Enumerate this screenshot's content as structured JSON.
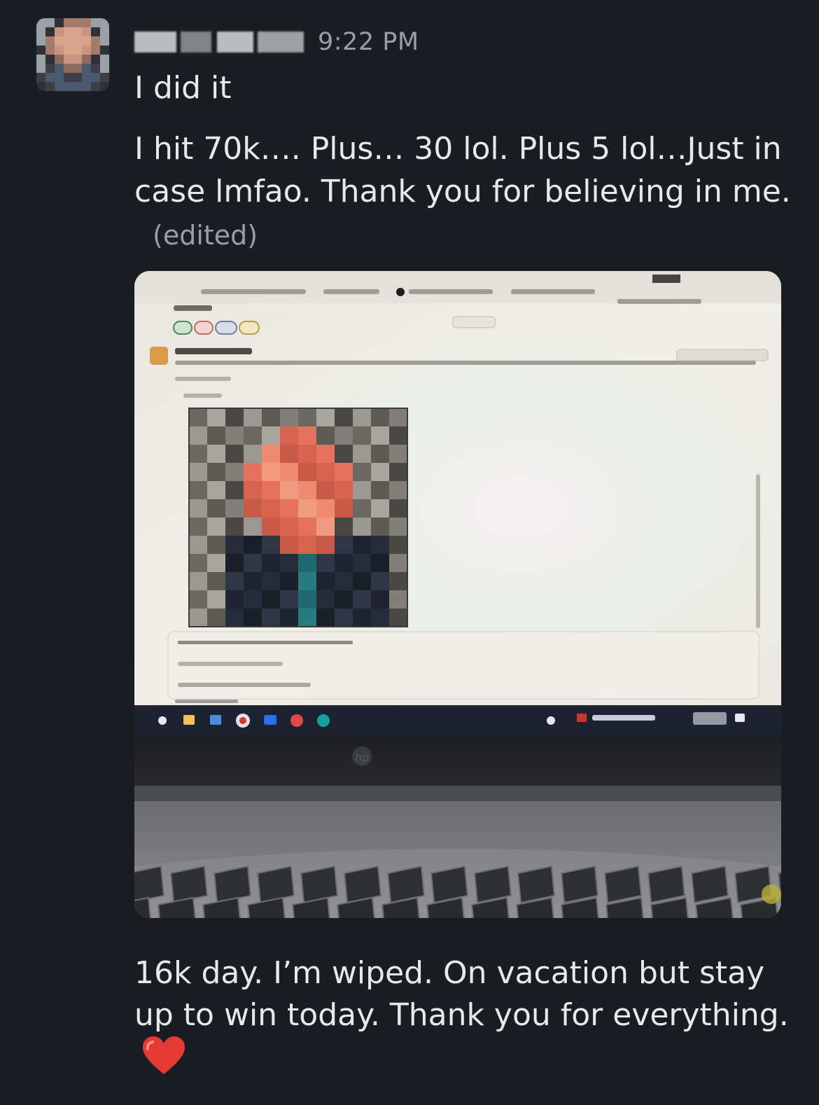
{
  "message": {
    "author_redacted": true,
    "timestamp": "9:22 PM",
    "text_first": "I did it",
    "text_second": "I hit 70k…. Plus… 30 lol. Plus 5 lol…Just in case lmfao. Thank you for believing in me.",
    "edited_label": "(edited)",
    "text_third": "16k day. I’m wiped. On vacation but stay up to win today. Thank you for everything.",
    "emoji": "red-heart-icon"
  },
  "attachment": {
    "description_icon": "photo-attachment",
    "laptop_brand_icon": "hp-logo-icon"
  },
  "colors": {
    "background": "#1a1d21",
    "text": "#e8e9ea",
    "muted": "#9b9ea3",
    "heart": "#e53935"
  }
}
